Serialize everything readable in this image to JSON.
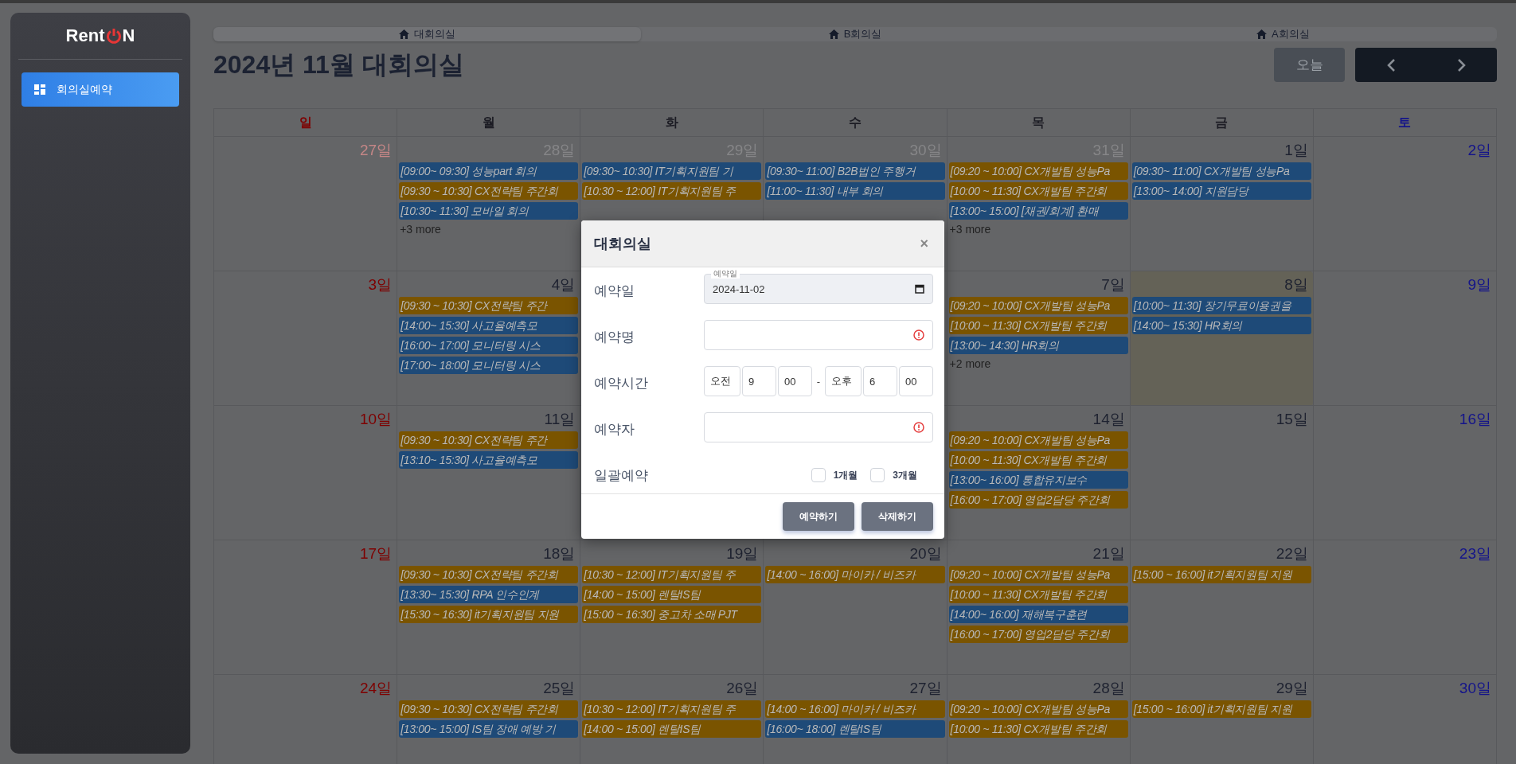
{
  "sidebar": {
    "logo": {
      "before": "Rent",
      "after": "N"
    },
    "items": [
      {
        "label": "회의실예약",
        "selected": true
      }
    ]
  },
  "tabs": [
    {
      "label": "대회의실",
      "selected": true
    },
    {
      "label": "B회의실",
      "selected": false
    },
    {
      "label": "A회의실",
      "selected": false
    }
  ],
  "toolbar": {
    "title": "2024년 11월 대회의실",
    "today": "오늘"
  },
  "calendar": {
    "weekdays": [
      "일",
      "월",
      "화",
      "수",
      "목",
      "금",
      "토"
    ],
    "weeks": [
      [
        {
          "date": "27일",
          "other_month": true,
          "today": false
        },
        {
          "date": "28일",
          "other_month": true,
          "today": false,
          "events": [
            {
              "text": "[09:00~ 09:30] 성능part 회의",
              "color": "#1e4a78"
            },
            {
              "text": "[09:30 ~ 10:30] CX전략팀 주간회",
              "color": "#7a5400"
            },
            {
              "text": "[10:30~ 11:30] 모바일 회의",
              "color": "#1e4a78"
            }
          ],
          "more": "+3 more"
        },
        {
          "date": "29일",
          "other_month": true,
          "today": false,
          "events": [
            {
              "text": "[09:30~ 10:30] IT기획지원팀 기",
              "color": "#1e4a78"
            },
            {
              "text": "[10:30 ~ 12:00] IT기획지원팀 주",
              "color": "#7a5400"
            }
          ]
        },
        {
          "date": "30일",
          "other_month": true,
          "today": false,
          "events": [
            {
              "text": "[09:30~ 11:00] B2B법인 주행거",
              "color": "#1e4a78"
            },
            {
              "text": "[11:00~ 11:30] 내부 회의",
              "color": "#1e4a78"
            }
          ]
        },
        {
          "date": "31일",
          "other_month": true,
          "today": false,
          "events": [
            {
              "text": "[09:20 ~ 10:00] CX개발팀 성능Pa",
              "color": "#7a5400"
            },
            {
              "text": "[10:00 ~ 11:30] CX개발팀 주간회",
              "color": "#7a5400"
            },
            {
              "text": "[13:00~ 15:00] [채권/회계] 환매",
              "color": "#1e4a78"
            }
          ],
          "more": "+3 more"
        },
        {
          "date": "1일",
          "other_month": false,
          "today": false,
          "events": [
            {
              "text": "[09:30~ 11:00] CX개발팀 성능Pa",
              "color": "#1e4a78"
            },
            {
              "text": "[13:00~ 14:00] 지원담당",
              "color": "#1e4a78"
            }
          ]
        },
        {
          "date": "2일",
          "other_month": false,
          "today": false
        }
      ],
      [
        {
          "date": "3일",
          "other_month": false,
          "today": false
        },
        {
          "date": "4일",
          "other_month": false,
          "today": false,
          "events": [
            {
              "text": "[09:30 ~ 10:30] CX전략팀 주간",
              "color": "#7a5400"
            },
            {
              "text": "[14:00~ 15:30] 사고율예측모",
              "color": "#1e4a78"
            },
            {
              "text": "[16:00~ 17:00] 모니터링 시스",
              "color": "#1e4a78"
            },
            {
              "text": "[17:00~ 18:00] 모니터링 시스",
              "color": "#1e4a78"
            }
          ]
        },
        {
          "date": "7일",
          "other_month": false,
          "today": false,
          "events": [
            {
              "text": "[09:20 ~ 10:00] CX개발팀 성능Pa",
              "color": "#7a5400"
            },
            {
              "text": "[10:00 ~ 11:30] CX개발팀 주간회",
              "color": "#7a5400"
            },
            {
              "text": "[13:00~ 14:30] HR회의",
              "color": "#1e4a78"
            }
          ],
          "more": "+2 more"
        },
        {
          "date": "8일",
          "other_month": false,
          "today": true,
          "events": [
            {
              "text": "[10:00~ 11:30] 장기무료이용권을",
              "color": "#1e4a78"
            },
            {
              "text": "[14:00~ 15:30] HR회의",
              "color": "#1e4a78"
            }
          ]
        },
        {
          "date": "9일",
          "other_month": false,
          "today": false
        }
      ],
      [
        {
          "date": "10일",
          "other_month": false,
          "today": false
        },
        {
          "date": "11일",
          "other_month": false,
          "today": false,
          "events": [
            {
              "text": "[09:30 ~ 10:30] CX전략팀 주간",
              "color": "#7a5400"
            },
            {
              "text": "[13:10~ 15:30] 사고율예측모",
              "color": "#1e4a78"
            }
          ]
        },
        {
          "date": "14일",
          "other_month": false,
          "today": false,
          "events": [
            {
              "text": "[09:20 ~ 10:00] CX개발팀 성능Pa",
              "color": "#7a5400"
            },
            {
              "text": "[10:00 ~ 11:30] CX개발팀 주간회",
              "color": "#7a5400"
            },
            {
              "text": "[13:00~ 16:00] 통합유지보수",
              "color": "#1e4a78"
            },
            {
              "text": "[16:00 ~ 17:00] 영업2담당 주간회",
              "color": "#7a5400"
            }
          ]
        },
        {
          "date": "15일",
          "other_month": false,
          "today": false
        },
        {
          "date": "16일",
          "other_month": false,
          "today": false
        }
      ],
      [
        {
          "date": "17일",
          "other_month": false,
          "today": false
        },
        {
          "date": "18일",
          "other_month": false,
          "today": false,
          "events": [
            {
              "text": "[09:30 ~ 10:30] CX전략팀 주간회",
              "color": "#7a5400"
            },
            {
              "text": "[13:30~ 15:30] RPA 인수인계",
              "color": "#1e4a78"
            },
            {
              "text": "[15:30 ~ 16:30] it기획지원팀 지원",
              "color": "#7a5400"
            }
          ]
        },
        {
          "date": "19일",
          "other_month": false,
          "today": false,
          "events": [
            {
              "text": "[10:30 ~ 12:00] IT기획지원팀 주",
              "color": "#7a5400"
            },
            {
              "text": "[14:00 ~ 15:00] 렌탈IS팀",
              "color": "#7a5400"
            },
            {
              "text": "[15:00 ~ 16:30] 중고차 소매 PJT",
              "color": "#7a5400"
            }
          ]
        },
        {
          "date": "20일",
          "other_month": false,
          "today": false,
          "events": [
            {
              "text": "[14:00 ~ 16:00] 마이카 / 비즈카",
              "color": "#7a5400"
            }
          ]
        },
        {
          "date": "21일",
          "other_month": false,
          "today": false,
          "events": [
            {
              "text": "[09:20 ~ 10:00] CX개발팀 성능Pa",
              "color": "#7a5400"
            },
            {
              "text": "[10:00 ~ 11:30] CX개발팀 주간회",
              "color": "#7a5400"
            },
            {
              "text": "[14:00~ 16:00] 재해복구훈련",
              "color": "#1e4a78"
            },
            {
              "text": "[16:00 ~ 17:00] 영업2담당 주간회",
              "color": "#7a5400"
            }
          ]
        },
        {
          "date": "22일",
          "other_month": false,
          "today": false,
          "events": [
            {
              "text": "[15:00 ~ 16:00] it기획지원팀 지원",
              "color": "#7a5400"
            }
          ]
        },
        {
          "date": "23일",
          "other_month": false,
          "today": false
        }
      ],
      [
        {
          "date": "24일",
          "other_month": false,
          "today": false
        },
        {
          "date": "25일",
          "other_month": false,
          "today": false,
          "events": [
            {
              "text": "[09:30 ~ 10:30] CX전략팀 주간회",
              "color": "#7a5400"
            },
            {
              "text": "[13:00~ 15:00] IS팀 장애 예방 기",
              "color": "#1e4a78"
            }
          ]
        },
        {
          "date": "26일",
          "other_month": false,
          "today": false,
          "events": [
            {
              "text": "[10:30 ~ 12:00] IT기획지원팀 주",
              "color": "#7a5400"
            },
            {
              "text": "[14:00 ~ 15:00] 렌탈IS팀",
              "color": "#7a5400"
            }
          ]
        },
        {
          "date": "27일",
          "other_month": false,
          "today": false,
          "events": [
            {
              "text": "[14:00 ~ 16:00] 마이카 / 비즈카",
              "color": "#7a5400"
            },
            {
              "text": "[16:00~ 18:00] 렌탈IS팀",
              "color": "#1e4a78"
            }
          ]
        },
        {
          "date": "28일",
          "other_month": false,
          "today": false,
          "events": [
            {
              "text": "[09:20 ~ 10:00] CX개발팀 성능Pa",
              "color": "#7a5400"
            },
            {
              "text": "[10:00 ~ 11:30] CX개발팀 주간회",
              "color": "#7a5400"
            }
          ]
        },
        {
          "date": "29일",
          "other_month": false,
          "today": false,
          "events": [
            {
              "text": "[15:00 ~ 16:00] it기획지원팀 지원",
              "color": "#7a5400"
            }
          ]
        },
        {
          "date": "30일",
          "other_month": false,
          "today": false
        }
      ]
    ]
  },
  "modal": {
    "title": "대회의실",
    "close": "×",
    "fields": [
      {
        "kind": "date",
        "label": "예약일",
        "floating_label": "예약일",
        "value": "2024-11-02"
      },
      {
        "kind": "text",
        "label": "예약명",
        "invalid": true
      },
      {
        "kind": "time",
        "label": "예약시간",
        "start": {
          "period": "오전",
          "hour": "9",
          "minute": "00"
        },
        "separator": "-",
        "end": {
          "period": "오후",
          "hour": "6",
          "minute": "00"
        }
      },
      {
        "kind": "text",
        "label": "예약자",
        "invalid": true
      },
      {
        "kind": "checks",
        "label": "일괄예약",
        "options": [
          {
            "label": "1개월",
            "checked": false
          },
          {
            "label": "3개월",
            "checked": false
          }
        ]
      }
    ],
    "buttons": [
      "예약하기",
      "삭제하기"
    ]
  }
}
